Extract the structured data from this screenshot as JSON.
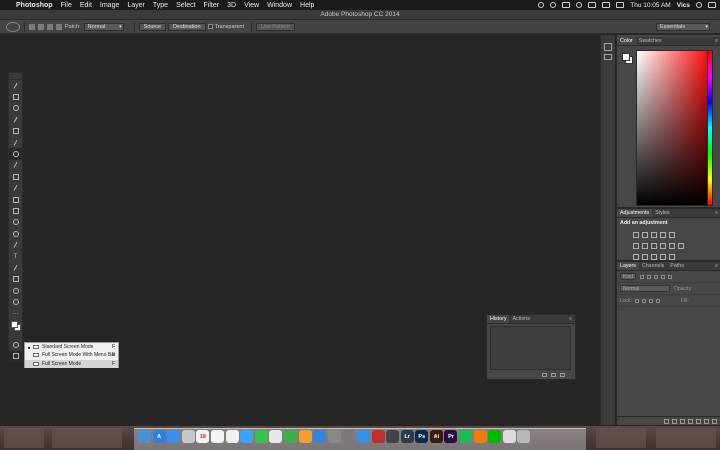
{
  "menubar": {
    "apple_glyph": "",
    "app_name": "Photoshop",
    "items": [
      "File",
      "Edit",
      "Image",
      "Layer",
      "Type",
      "Select",
      "Filter",
      "3D",
      "View",
      "Window",
      "Help"
    ],
    "clock": "Thu 10:05 AM",
    "user": "Vics"
  },
  "window": {
    "title": "Adobe Photoshop CC 2014"
  },
  "options_bar": {
    "patch_label": "Patch:",
    "patch_value": "Normal",
    "source_label": "Source",
    "destination_label": "Destination",
    "transparent_label": "Transparent",
    "use_pattern_label": "Use Pattern",
    "workspace_value": "Essentials"
  },
  "screen_mode_menu": {
    "items": [
      {
        "label": "Standard Screen Mode",
        "key": "F"
      },
      {
        "label": "Full Screen Mode With Menu Bar",
        "key": "F"
      },
      {
        "label": "Full Screen Mode",
        "key": "F"
      }
    ]
  },
  "color_panel": {
    "tabs": [
      "Color",
      "Swatches"
    ],
    "foreground": "#ffffff",
    "background": "#ffffff",
    "hue_base": "#ff0000"
  },
  "adjustments_panel": {
    "tabs": [
      "Adjustments",
      "Styles"
    ],
    "title": "Add an adjustment"
  },
  "layers_panel": {
    "tabs": [
      "Layers",
      "Channels",
      "Paths"
    ],
    "kind_filter": "Kind",
    "blend_mode": "Normal",
    "opacity_label": "Opacity:",
    "lock_label": "Lock:",
    "fill_label": "Fill:"
  },
  "history_panel": {
    "tabs": [
      "History",
      "Actions"
    ]
  },
  "dock": {
    "items": [
      {
        "name": "finder-icon",
        "color": "#4a90d9",
        "glyph": ""
      },
      {
        "name": "app-store-icon",
        "color": "#2f7fe0",
        "glyph": "A"
      },
      {
        "name": "safari-icon",
        "color": "#3a8fe8",
        "glyph": ""
      },
      {
        "name": "mail-icon",
        "color": "#c8c8c8",
        "glyph": ""
      },
      {
        "name": "calendar-icon",
        "color": "#f2f2f2",
        "glyph": "18"
      },
      {
        "name": "notes-icon",
        "color": "#f5f5f5",
        "glyph": ""
      },
      {
        "name": "reminders-icon",
        "color": "#f0f0f0",
        "glyph": ""
      },
      {
        "name": "messages-icon",
        "color": "#3da4f5",
        "glyph": ""
      },
      {
        "name": "facetime-icon",
        "color": "#3cbf4c",
        "glyph": ""
      },
      {
        "name": "photos-icon",
        "color": "#e8e8e8",
        "glyph": ""
      },
      {
        "name": "numbers-icon",
        "color": "#3caf49",
        "glyph": ""
      },
      {
        "name": "pages-icon",
        "color": "#f0a030",
        "glyph": ""
      },
      {
        "name": "keynote-icon",
        "color": "#3a84d6",
        "glyph": ""
      },
      {
        "name": "preview-icon",
        "color": "#888888",
        "glyph": ""
      },
      {
        "name": "system-prefs-icon",
        "color": "#7a7a7a",
        "glyph": ""
      },
      {
        "name": "itunes-icon",
        "color": "#3a8fe8",
        "glyph": ""
      },
      {
        "name": "photobooth-icon",
        "color": "#c03030",
        "glyph": ""
      },
      {
        "name": "final-cut-icon",
        "color": "#444444",
        "glyph": ""
      },
      {
        "name": "lightroom-icon",
        "color": "#2d3c4c",
        "glyph": "Lr"
      },
      {
        "name": "photoshop-icon",
        "color": "#0d2c4f",
        "glyph": "Ps"
      },
      {
        "name": "illustrator-icon",
        "color": "#3b1c0a",
        "glyph": "Ai"
      },
      {
        "name": "premiere-icon",
        "color": "#2a0f3f",
        "glyph": "Pr"
      },
      {
        "name": "spotify-icon",
        "color": "#1db954",
        "glyph": ""
      },
      {
        "name": "vlc-icon",
        "color": "#f07c10",
        "glyph": ""
      },
      {
        "name": "line-icon",
        "color": "#00b900",
        "glyph": ""
      },
      {
        "name": "downloads-icon",
        "color": "#dcdcdc",
        "glyph": ""
      },
      {
        "name": "trash-icon",
        "color": "#b8b8b8",
        "glyph": ""
      }
    ]
  }
}
